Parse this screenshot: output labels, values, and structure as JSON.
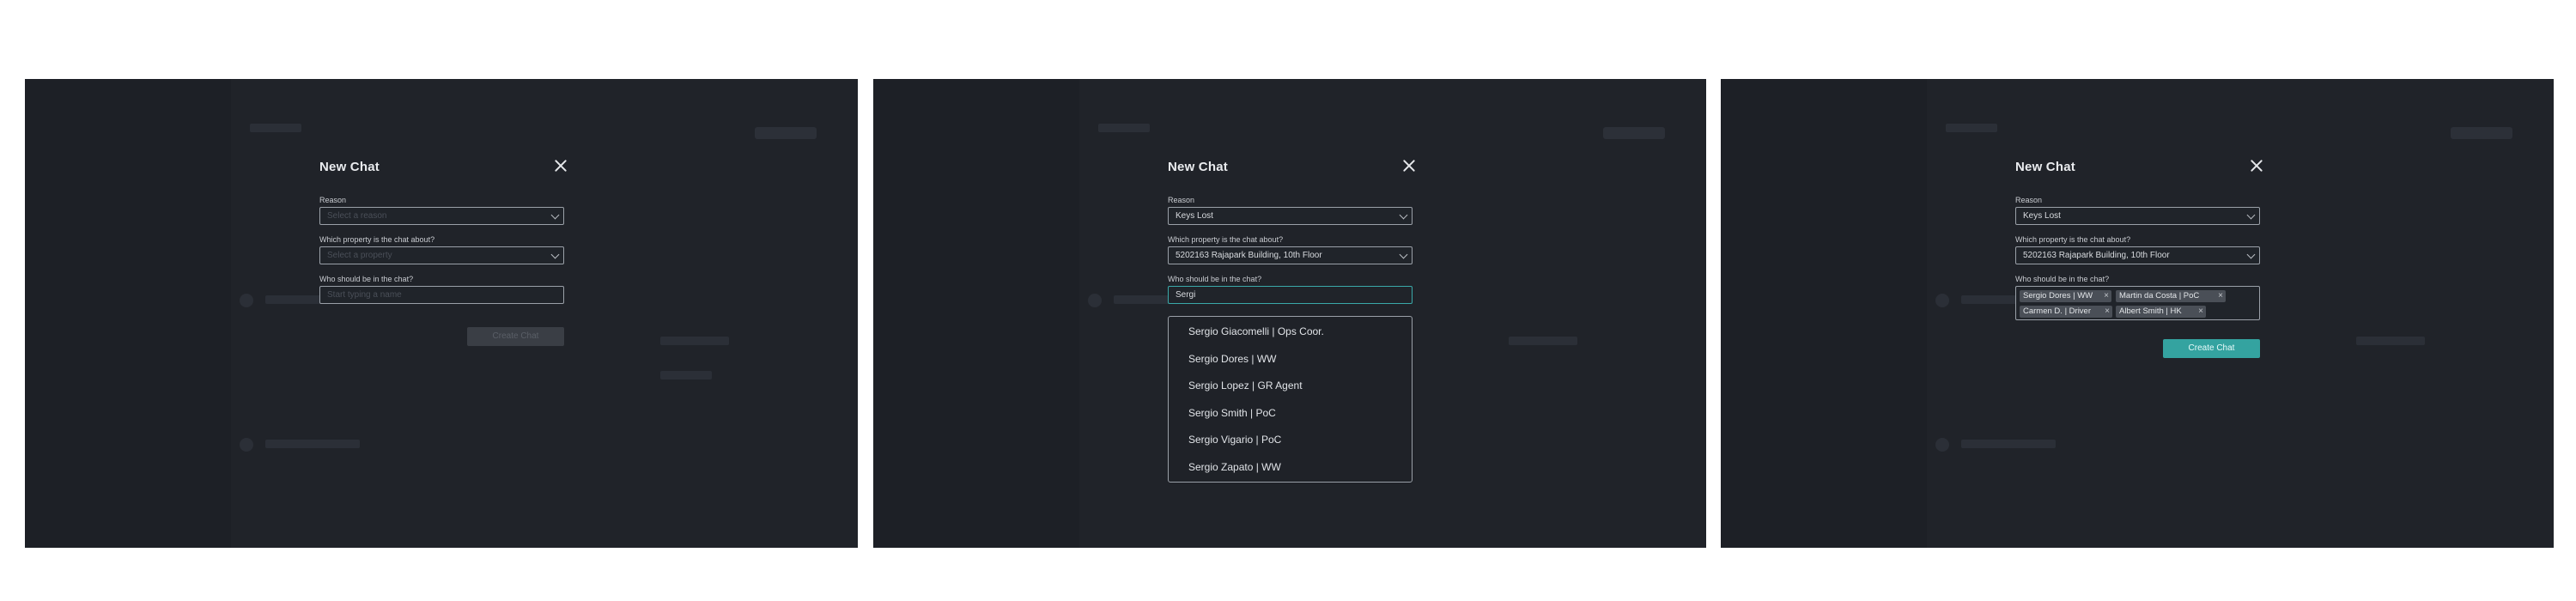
{
  "panels": [
    {
      "dialog": {
        "title": "New Chat",
        "reason_label": "Reason",
        "reason_placeholder": "Select a reason",
        "property_label": "Which property is the chat about?",
        "property_placeholder": "Select a property",
        "participants_label": "Who should be in the chat?",
        "participants_placeholder": "Start typing a name",
        "create_button": "Create Chat"
      }
    },
    {
      "dialog": {
        "title": "New Chat",
        "reason_label": "Reason",
        "reason_value": "Keys Lost",
        "property_label": "Which property is the chat about?",
        "property_value": "5202163 Rajapark Building, 10th Floor",
        "participants_label": "Who should be in the chat?",
        "participants_value": "Sergi",
        "suggestions": [
          "Sergio Giacomelli | Ops Coor.",
          "Sergio Dores | WW",
          "Sergio Lopez | GR Agent",
          "Sergio Smith | PoC",
          "Sergio Vigario | PoC",
          "Sergio Zapato | WW"
        ]
      }
    },
    {
      "dialog": {
        "title": "New Chat",
        "reason_label": "Reason",
        "reason_value": "Keys Lost",
        "property_label": "Which property is the chat about?",
        "property_value": "5202163 Rajapark Building, 10th Floor",
        "participants_label": "Who should be in the chat?",
        "participants": [
          "Sergio Dores | WW",
          "Martin da Costa | PoC",
          "Carmen D. | Driver",
          "Albert Smith | HK"
        ],
        "create_button": "Create Chat"
      }
    }
  ],
  "colors": {
    "background": "#202329",
    "accent": "#34a3a0",
    "focus_border": "#3aa9a9",
    "chip": "#4a4f57"
  },
  "icons": [
    "close-icon",
    "chevron-down-icon",
    "chip-remove-icon"
  ]
}
